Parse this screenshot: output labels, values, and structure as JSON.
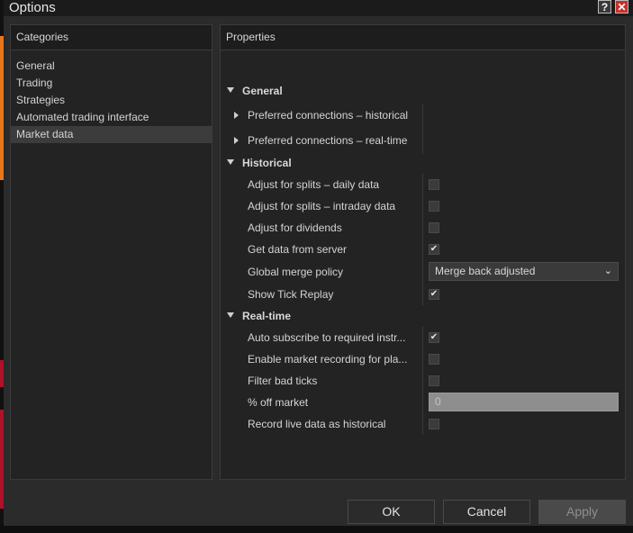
{
  "window": {
    "title": "Options",
    "help_label": "?",
    "close_label": "✕"
  },
  "categories": {
    "header": "Categories",
    "items": [
      {
        "label": "General"
      },
      {
        "label": "Trading"
      },
      {
        "label": "Strategies"
      },
      {
        "label": "Automated trading interface"
      },
      {
        "label": "Market data",
        "selected": true
      }
    ]
  },
  "properties": {
    "header": "Properties",
    "general": {
      "label": "General",
      "preferred_historical": "Preferred connections – historical",
      "preferred_realtime": "Preferred connections – real-time"
    },
    "historical": {
      "label": "Historical",
      "adjust_splits_daily": {
        "label": "Adjust for splits – daily data",
        "checked": false
      },
      "adjust_splits_intraday": {
        "label": "Adjust for splits – intraday data",
        "checked": false
      },
      "adjust_dividends": {
        "label": "Adjust for dividends",
        "checked": false
      },
      "get_data_server": {
        "label": "Get data from server",
        "checked": true
      },
      "global_merge": {
        "label": "Global merge policy",
        "value": "Merge back adjusted"
      },
      "show_tick_replay": {
        "label": "Show Tick Replay",
        "checked": true
      }
    },
    "realtime": {
      "label": "Real-time",
      "auto_subscribe": {
        "label": "Auto subscribe to required instr...",
        "checked": true
      },
      "enable_recording": {
        "label": "Enable market recording for pla...",
        "checked": false
      },
      "filter_bad_ticks": {
        "label": "Filter bad ticks",
        "checked": false
      },
      "pct_off_market": {
        "label": "% off market",
        "value": "0"
      },
      "record_live": {
        "label": "Record live data as historical",
        "checked": false
      }
    }
  },
  "buttons": {
    "ok": "OK",
    "cancel": "Cancel",
    "apply": "Apply"
  },
  "check_glyph": "✔",
  "chevron_glyph": "⌄"
}
